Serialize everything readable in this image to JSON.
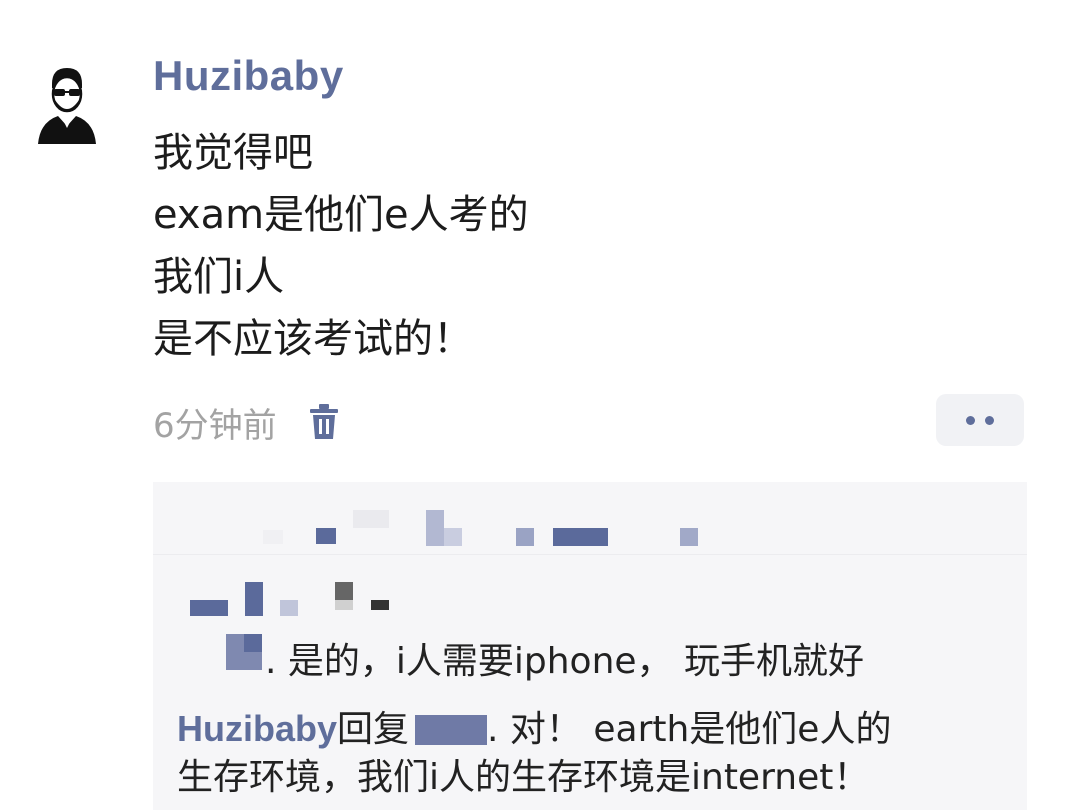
{
  "comment": {
    "username": "Huzibaby",
    "lines": [
      "我觉得吧",
      "exam是他们e人考的",
      "我们i人",
      "是不应该考试的！"
    ],
    "timestamp": "6分钟前"
  },
  "icons": {
    "avatar": "avatar-sunglasses-man-icon",
    "delete": "trash-icon",
    "more": "more-dots-icon"
  },
  "replies": {
    "reply1_text": ". 是的，i人需要iphone， 玩手机就好",
    "reply2_user": "Huzibaby",
    "reply2_prefix": "回复",
    "reply2_text": ". 对！ earth是他们e人的",
    "reply2_text_cont": "生存环境，我们i人的生存环境是internet！"
  },
  "colors": {
    "username": "#5f6e9b",
    "timestamp": "#a3a3a3",
    "reply_bg": "#f6f6f8"
  }
}
